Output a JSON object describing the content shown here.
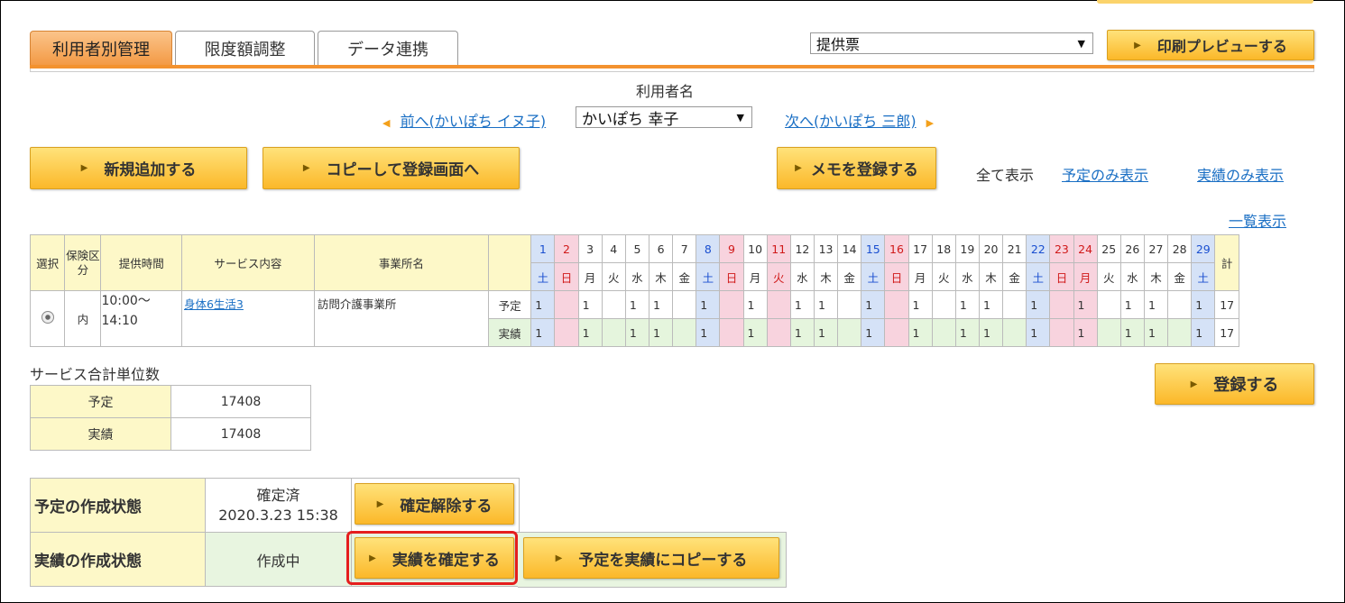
{
  "tabs": [
    {
      "label": "利用者別管理",
      "active": true
    },
    {
      "label": "限度額調整"
    },
    {
      "label": "データ連携"
    }
  ],
  "print": {
    "select_value": "提供票",
    "preview_button": "印刷プレビューする"
  },
  "user": {
    "heading": "利用者名",
    "prev_link": "前へ(かいぽち イヌ子)",
    "current": "かいぽち 幸子",
    "next_link": "次へ(かいぽち 三郎)"
  },
  "actions": {
    "add_new": "新規追加する",
    "copy_register": "コピーして登録画面へ",
    "memo": "メモを登録する"
  },
  "filters": {
    "all": "全て表示",
    "plan_only": "予定のみ表示",
    "actual_only": "実績のみ表示",
    "list_view": "一覧表示"
  },
  "grid": {
    "headers": {
      "select": "選択",
      "insurance": "保険区分",
      "time": "提供時間",
      "service": "サービス内容",
      "office": "事業所名",
      "total": "計"
    },
    "days": [
      "1",
      "2",
      "3",
      "4",
      "5",
      "6",
      "7",
      "8",
      "9",
      "10",
      "11",
      "12",
      "13",
      "14",
      "15",
      "16",
      "17",
      "18",
      "19",
      "20",
      "21",
      "22",
      "23",
      "24",
      "25",
      "26",
      "27",
      "28",
      "29"
    ],
    "weekdays": [
      "土",
      "日",
      "月",
      "火",
      "水",
      "木",
      "金",
      "土",
      "日",
      "月",
      "火",
      "水",
      "木",
      "金",
      "土",
      "日",
      "月",
      "火",
      "水",
      "木",
      "金",
      "土",
      "日",
      "月",
      "火",
      "水",
      "木",
      "金",
      "土"
    ],
    "day_types": [
      "sat",
      "sun",
      "",
      "",
      "",
      "",
      "",
      "sat",
      "sun",
      "",
      "hol",
      "",
      "",
      "",
      "sat",
      "sun",
      "",
      "",
      "",
      "",
      "",
      "sat",
      "sun",
      "hol",
      "",
      "",
      "",
      "",
      "sat"
    ],
    "row": {
      "insurance": "内",
      "time_start": "10:00〜",
      "time_end": "14:10",
      "service": "身体6生活3",
      "office": "訪問介護事業所",
      "plan_label": "予定",
      "actual_label": "実績",
      "plan": [
        "1",
        "",
        "1",
        "",
        "1",
        "1",
        "",
        "1",
        "",
        "1",
        "",
        "1",
        "1",
        "",
        "1",
        "",
        "1",
        "",
        "1",
        "1",
        "",
        "1",
        "",
        "1",
        "",
        "1",
        "1",
        "",
        "1"
      ],
      "actual": [
        "1",
        "",
        "1",
        "",
        "1",
        "1",
        "",
        "1",
        "",
        "1",
        "",
        "1",
        "1",
        "",
        "1",
        "",
        "1",
        "",
        "1",
        "1",
        "",
        "1",
        "",
        "1",
        "",
        "1",
        "1",
        "",
        "1"
      ],
      "plan_total": "17",
      "actual_total": "17"
    }
  },
  "summary": {
    "title": "サービス合計単位数",
    "plan_label": "予定",
    "plan_value": "17408",
    "actual_label": "実績",
    "actual_value": "17408"
  },
  "register_button": "登録する",
  "status": {
    "plan_label": "予定の作成状態",
    "plan_state": "確定済",
    "plan_date": "2020.3.23 15:38",
    "unconfirm_button": "確定解除する",
    "actual_label": "実績の作成状態",
    "actual_state": "作成中",
    "confirm_button": "実績を確定する",
    "copy_button": "予定を実績にコピーする"
  }
}
